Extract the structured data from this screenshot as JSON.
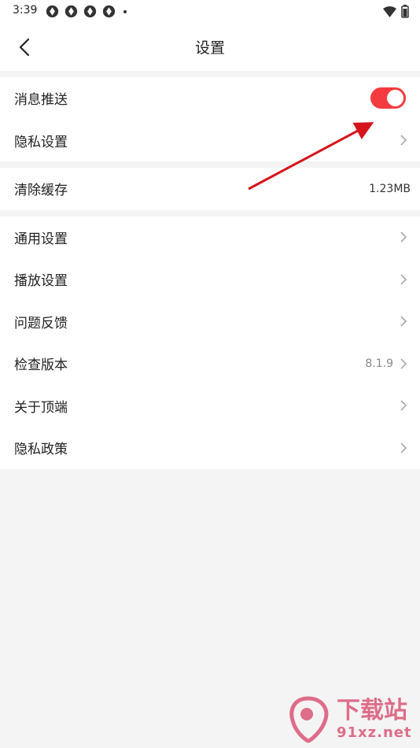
{
  "status_bar": {
    "time": "3:39",
    "notification_icons": [
      "app-icon",
      "app-icon",
      "app-icon",
      "app-icon"
    ]
  },
  "nav": {
    "title": "设置"
  },
  "groups": [
    {
      "rows": [
        {
          "label": "消息推送",
          "type": "toggle",
          "toggle_on": true
        },
        {
          "label": "隐私设置",
          "type": "chevron"
        }
      ]
    },
    {
      "rows": [
        {
          "label": "清除缓存",
          "type": "value",
          "value": "1.23MB"
        }
      ]
    },
    {
      "rows": [
        {
          "label": "通用设置",
          "type": "chevron"
        },
        {
          "label": "播放设置",
          "type": "chevron"
        },
        {
          "label": "问题反馈",
          "type": "chevron"
        },
        {
          "label": "检查版本",
          "type": "chevron",
          "value": "8.1.9"
        },
        {
          "label": "关于顶端",
          "type": "chevron"
        },
        {
          "label": "隐私政策",
          "type": "chevron"
        }
      ]
    }
  ],
  "colors": {
    "accent": "#f43b3f",
    "background": "#f4f4f4",
    "annotation_arrow": "#d6141c"
  },
  "watermark": {
    "brand": "下载站",
    "domain": "91xz.net"
  }
}
